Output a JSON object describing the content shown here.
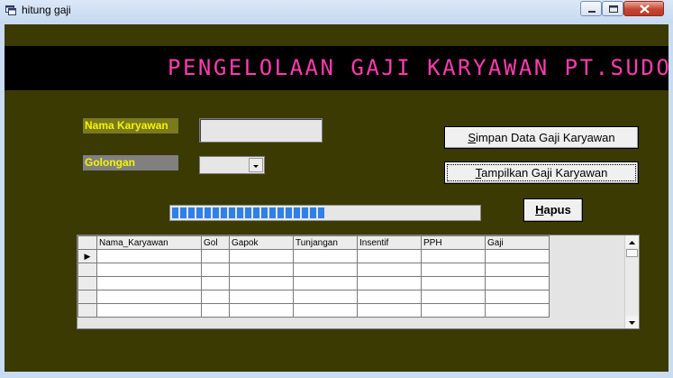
{
  "window": {
    "title": "hitung gaji",
    "icons": [
      "app-icon",
      "minimize-icon",
      "maximize-icon",
      "close-icon"
    ]
  },
  "banner": {
    "text": "PENGELOLAAN GAJI KARYAWAN PT.SUDO",
    "color": "#ff3cae"
  },
  "form": {
    "nama_label": "Nama Karyawan",
    "nama_value": "",
    "golongan_label": "Golongan",
    "golongan_value": ""
  },
  "buttons": {
    "simpan_prefix": "S",
    "simpan_rest": "impan Data Gaji Karyawan",
    "tampil_prefix": "T",
    "tampil_rest": "ampilkan Gaji Karyawan",
    "hapus_prefix": "H",
    "hapus_rest": "apus"
  },
  "progress": {
    "value": 0.5,
    "color": "#2f80e8"
  },
  "grid": {
    "columns": [
      "Nama_Karyawan",
      "Gol",
      "Gapok",
      "Tunjangan",
      "Insentif",
      "PPH",
      "Gaji"
    ],
    "rows": [
      [
        "",
        "",
        "",
        "",
        "",
        "",
        ""
      ],
      [
        "",
        "",
        "",
        "",
        "",
        "",
        ""
      ],
      [
        "",
        "",
        "",
        "",
        "",
        "",
        ""
      ],
      [
        "",
        "",
        "",
        "",
        "",
        "",
        ""
      ],
      [
        "",
        "",
        "",
        "",
        "",
        "",
        ""
      ]
    ],
    "current_row_marker": "▶"
  },
  "colors": {
    "client_bg": "#3a3a02",
    "label_text": "#f6f400"
  }
}
